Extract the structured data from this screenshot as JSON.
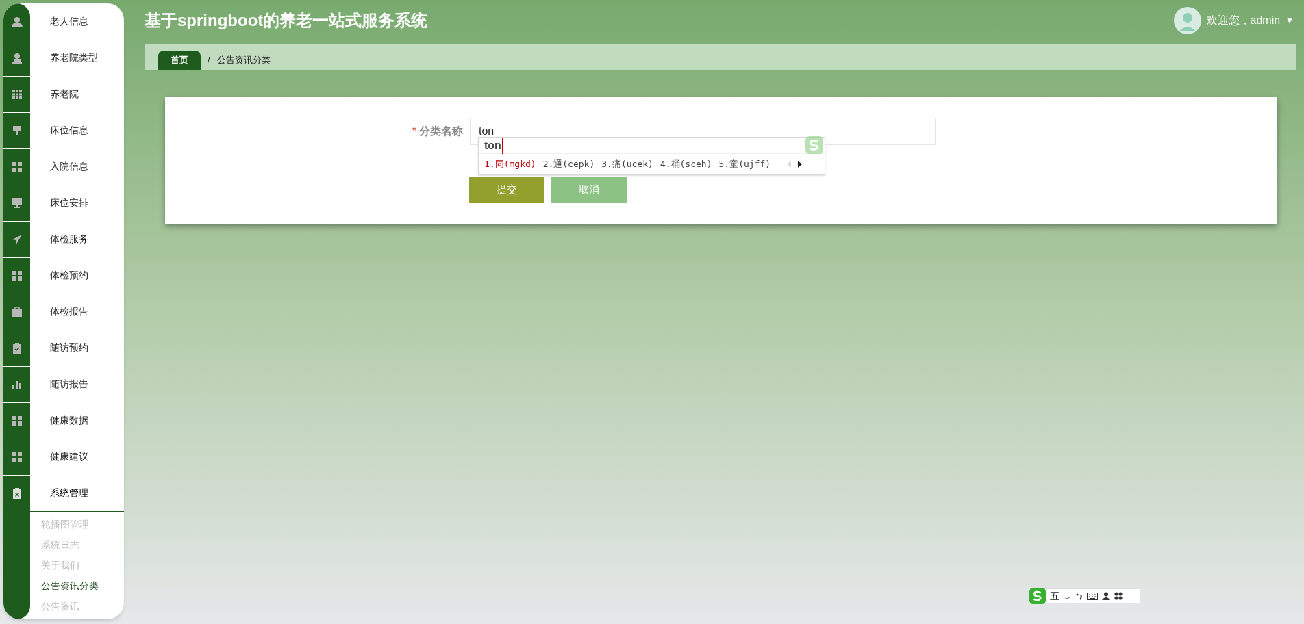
{
  "header": {
    "title": "基于springboot的养老一站式服务系统",
    "greeting": "欢迎您，admin",
    "caret": "▼"
  },
  "sidebar": {
    "items": [
      {
        "label": "老人信息",
        "expanded": false
      },
      {
        "label": "养老院类型",
        "expanded": false
      },
      {
        "label": "养老院",
        "expanded": false
      },
      {
        "label": "床位信息",
        "expanded": false
      },
      {
        "label": "入院信息",
        "expanded": false
      },
      {
        "label": "床位安排",
        "expanded": false
      },
      {
        "label": "体检服务",
        "expanded": false
      },
      {
        "label": "体检预约",
        "expanded": false
      },
      {
        "label": "体检报告",
        "expanded": false
      },
      {
        "label": "随访预约",
        "expanded": false
      },
      {
        "label": "随访报告",
        "expanded": false
      },
      {
        "label": "健康数据",
        "expanded": false
      },
      {
        "label": "健康建议",
        "expanded": false
      },
      {
        "label": "系统管理",
        "expanded": true,
        "children": [
          {
            "label": "轮播图管理",
            "selected": false
          },
          {
            "label": "系统日志",
            "selected": false
          },
          {
            "label": "关于我们",
            "selected": false
          },
          {
            "label": "公告资讯分类",
            "selected": true
          },
          {
            "label": "公告资讯",
            "selected": false
          }
        ]
      }
    ]
  },
  "breadcrumb": [
    "首页",
    "/",
    "公告资讯分类"
  ],
  "form": {
    "required_mark": "*",
    "label": "分类名称",
    "value": "ton",
    "buttons": [
      {
        "label": "提交",
        "kind": "primary"
      },
      {
        "label": "取消",
        "kind": "secondary"
      }
    ]
  },
  "ime": {
    "composition": "ton",
    "candidates": [
      {
        "label": "1.同(mgkd)",
        "selected": true
      },
      {
        "label": "2.通(cepk)",
        "selected": false
      },
      {
        "label": "3.痛(ucek)",
        "selected": false
      },
      {
        "label": "4.桶(sceh)",
        "selected": false
      },
      {
        "label": "5.童(ujff)",
        "selected": false
      }
    ],
    "toolbar_mode": "五"
  }
}
